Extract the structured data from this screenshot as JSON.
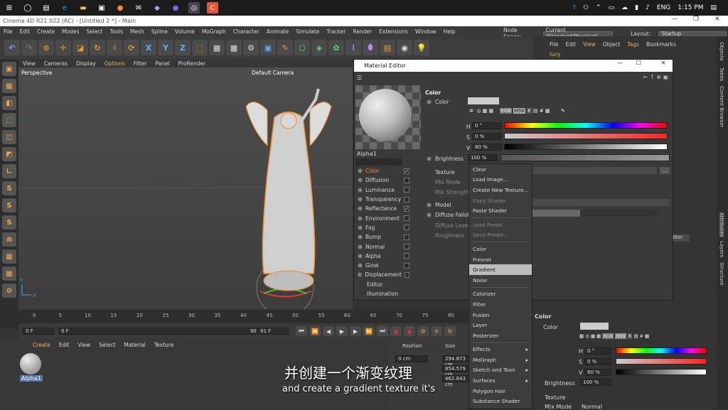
{
  "taskbar": {
    "tray": {
      "lang": "ENG",
      "time": "1:15 PM"
    }
  },
  "window": {
    "title": "Cinema 4D R21.022 (RC) - [Untitled 2 *] - Main"
  },
  "menubar": {
    "items": [
      "File",
      "Edit",
      "Create",
      "Modes",
      "Select",
      "Tools",
      "Mesh",
      "Spline",
      "Volume",
      "MoGraph",
      "Character",
      "Animate",
      "Simulate",
      "Tracker",
      "Render",
      "Extensions",
      "Window",
      "Help"
    ],
    "node_space_label": "Node Space:",
    "node_space_value": "Current (Standard/Physical)",
    "layout_label": "Layout:",
    "layout_value": "Startup"
  },
  "viewport": {
    "menu": [
      "View",
      "Cameras",
      "Display",
      "Options",
      "Filter",
      "Panel",
      "ProRender"
    ],
    "label": "Perspective",
    "camera": "Default Camera"
  },
  "timeline": {
    "ticks": [
      "0",
      "5",
      "10",
      "15",
      "20",
      "25",
      "30",
      "35",
      "40",
      "45",
      "50",
      "55",
      "60",
      "65",
      "70",
      "75",
      "80",
      "85"
    ],
    "start": "0 F",
    "current": "0 F",
    "end": "90 F",
    "end2": "91 F"
  },
  "material_manager": {
    "menu": [
      "Create",
      "Edit",
      "View",
      "Select",
      "Material",
      "Texture"
    ],
    "material_name": "Alpha1"
  },
  "coords": {
    "position": "Position",
    "size": "Size",
    "x": "0 cm",
    "sizes": [
      "294.873 cm",
      "854.579 cm",
      "462.843 cm"
    ]
  },
  "object_manager": {
    "menu": [
      "File",
      "Edit",
      "View",
      "Object",
      "Tags",
      "Bookmarks"
    ],
    "lucy": "lucy"
  },
  "side_tabs": [
    "Objects",
    "Takes",
    "Content Browser",
    "Attributes",
    "Layers",
    "Structure"
  ],
  "material_editor": {
    "title": "Material Editor",
    "name": "Alpha1",
    "channels": [
      {
        "label": "Color",
        "checked": true,
        "selected": true
      },
      {
        "label": "Diffusion",
        "checked": false
      },
      {
        "label": "Luminance",
        "checked": false
      },
      {
        "label": "Transparency",
        "checked": false
      },
      {
        "label": "Reflectance",
        "checked": true
      },
      {
        "label": "Environment",
        "checked": false
      },
      {
        "label": "Fog",
        "checked": false
      },
      {
        "label": "Bump",
        "checked": false
      },
      {
        "label": "Normal",
        "checked": false
      },
      {
        "label": "Alpha",
        "checked": false
      },
      {
        "label": "Glow",
        "checked": false
      },
      {
        "label": "Displacement",
        "checked": false
      },
      {
        "label": "Editor",
        "checked": null
      },
      {
        "label": "Illumination",
        "checked": null
      }
    ],
    "section": "Color",
    "color_label": "Color",
    "color_modes": [
      "RGB",
      "HSV",
      "K"
    ],
    "h": "0 °",
    "s": "0 %",
    "v": "80 %",
    "brightness_label": "Brightness",
    "brightness": "100 %",
    "texture_label": "Texture",
    "mix_mode_label": "Mix Mode",
    "mix_strength_label": "Mix Strength",
    "model_label": "Model",
    "diffuse_falloff_label": "Diffuse Falloff",
    "diffuse_level_label": "Diffuse Level",
    "roughness_label": "Roughness"
  },
  "context_menu": {
    "groups": [
      [
        {
          "label": "Clear"
        },
        {
          "label": "Load Image..."
        },
        {
          "label": "Create New Texture..."
        },
        {
          "label": "Copy Shader",
          "disabled": true
        },
        {
          "label": "Paste Shader"
        }
      ],
      [
        {
          "label": "Load Preset",
          "disabled": true
        },
        {
          "label": "Save Preset...",
          "disabled": true
        }
      ],
      [
        {
          "label": "Color"
        },
        {
          "label": "Fresnel"
        },
        {
          "label": "Gradient",
          "highlight": true
        },
        {
          "label": "Noise"
        }
      ],
      [
        {
          "label": "Colorizer"
        },
        {
          "label": "Filter"
        },
        {
          "label": "Fusion"
        },
        {
          "label": "Layer"
        },
        {
          "label": "Posterizer"
        }
      ],
      [
        {
          "label": "Effects",
          "sub": true
        },
        {
          "label": "MoGraph",
          "sub": true
        },
        {
          "label": "Sketch and Toon",
          "sub": true
        },
        {
          "label": "Surfaces",
          "sub": true
        },
        {
          "label": "Polygon Hair"
        },
        {
          "label": "Substance Shader"
        }
      ]
    ]
  },
  "attributes": {
    "color_section": "Color",
    "color_label": "Color",
    "h": "0 °",
    "s": "0 %",
    "v": "80 %",
    "brightness_label": "Brightness",
    "brightness": "100 %",
    "texture_label": "Texture",
    "mix_mode_label": "Mix Mode",
    "mix_mode_value": "Normal",
    "editor_btn": "Editor"
  },
  "subtitles": {
    "zh": "并创建一个渐变纹理",
    "en": "and create a gradient texture it's"
  },
  "colors": {
    "accent_orange": "#f08a2a",
    "highlight_blue": "#5ab0ff"
  }
}
